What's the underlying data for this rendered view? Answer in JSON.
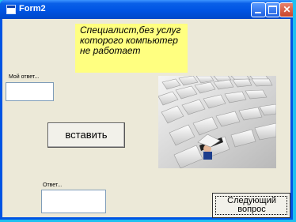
{
  "window": {
    "title": "Form2",
    "controls": [
      "minimize-icon",
      "maximize-icon",
      "close-icon"
    ]
  },
  "note": {
    "text": "Специалист,без услуг которого компьютер не работает",
    "background": "#ffff80"
  },
  "my_answer": {
    "label": "Мой ответ...",
    "value": ""
  },
  "insert_button": {
    "label": "вставить"
  },
  "answer": {
    "label": "Ответ...",
    "value": ""
  },
  "next_button": {
    "label": "Следующий вопрос"
  },
  "image": {
    "icon": "keyboard-with-tiny-person-image"
  },
  "colors": {
    "desktop": "#1ec0f0",
    "titlebar": "#0054e3",
    "client": "#ece9d8"
  }
}
